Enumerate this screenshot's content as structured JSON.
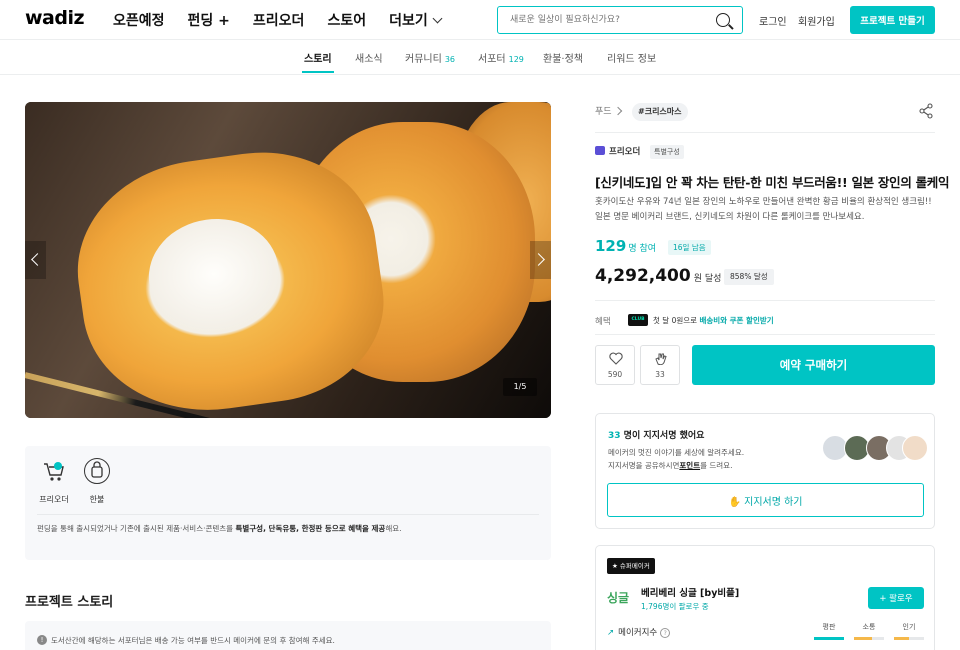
{
  "header": {
    "logo": "wadiz",
    "nav": [
      "오픈예정",
      "펀딩 +",
      "프리오더",
      "스토어",
      "더보기"
    ],
    "search_placeholder": "새로운 일상이 필요하신가요?",
    "login": "로그인",
    "signup": "회원가입",
    "make_project": "프로젝트 만들기"
  },
  "tabs": [
    {
      "label": "스토리",
      "count": ""
    },
    {
      "label": "새소식",
      "count": ""
    },
    {
      "label": "커뮤니티",
      "count": "36"
    },
    {
      "label": "서포터",
      "count": "129"
    },
    {
      "label": "환불·정책",
      "count": ""
    },
    {
      "label": "리워드 정보",
      "count": ""
    }
  ],
  "gallery": {
    "counter": "1/5"
  },
  "info": {
    "badges": [
      {
        "label": "프리오더",
        "icon": "cart-icon"
      },
      {
        "label": "한불",
        "icon": "bag-icon"
      }
    ],
    "text_prefix": "펀딩을 통해 출시되었거나 기존에 출시된 제품·서비스·콘텐츠를 ",
    "text_bold": "특별구성, 단독유통, 한정판 등으로 혜택을 제공",
    "text_suffix": "해요."
  },
  "story": {
    "title": "프로젝트 스토리",
    "notice": "도서산간에 해당하는 서포터님은 배송 가능 여부를 반드시 메이커에 문의 후 참여해 주세요."
  },
  "project": {
    "category": "푸드",
    "tag": "#크리스마스",
    "type": "프리오더",
    "type_badge": "특별구성",
    "title": "[신키네도]입 안 꽉 차는 탄탄-한 미친 부드러움!! 일본 장인의 롤케익",
    "description": "홋카이도산 우유와 74년 일본 장인의 노하우로 만들어낸 완벽한 황금 비율의 환상적인 생크림!! 일본 명문 베이커리 브랜드, 신키네도의 차원이 다른 롤케이크를 만나보세요.",
    "supporters": "129",
    "supporters_unit": "명 참여",
    "days_left": "16일 남음",
    "amount": "4,292,400",
    "amount_unit": "원 달성",
    "rate": "858% 달성",
    "benefit_label": "혜택",
    "club_label": "CLUB",
    "benefit_text": "첫 달 0원으로 ",
    "benefit_highlight": "배송비와 쿠폰 할인받기",
    "likes": "590",
    "cheers": "33",
    "buy_button": "예약 구매하기"
  },
  "signature": {
    "count": "33",
    "title_suffix": " 명이 지지서명 했어요",
    "desc_line1": "메이커의 멋진 이야기를 세상에 알려주세요.",
    "desc_line2_prefix": "지지서명을 공유하시면",
    "desc_line2_link": "포인트",
    "desc_line2_suffix": "를 드려요.",
    "button": "지지서명 하기"
  },
  "maker": {
    "badge": "슈퍼메이커",
    "logo_text": "싱글",
    "name": "베리베리 싱글 [by비플]",
    "followers": "1,796명이 팔로우 중",
    "follow_button": "+ 팔로우",
    "index_label": "메이커지수",
    "metrics": [
      {
        "label": "평판",
        "color": "#00c4c4",
        "level": 1.0
      },
      {
        "label": "소통",
        "color": "#f5b84a",
        "level": 0.6
      },
      {
        "label": "인기",
        "color": "#f5b84a",
        "level": 0.5
      }
    ]
  }
}
